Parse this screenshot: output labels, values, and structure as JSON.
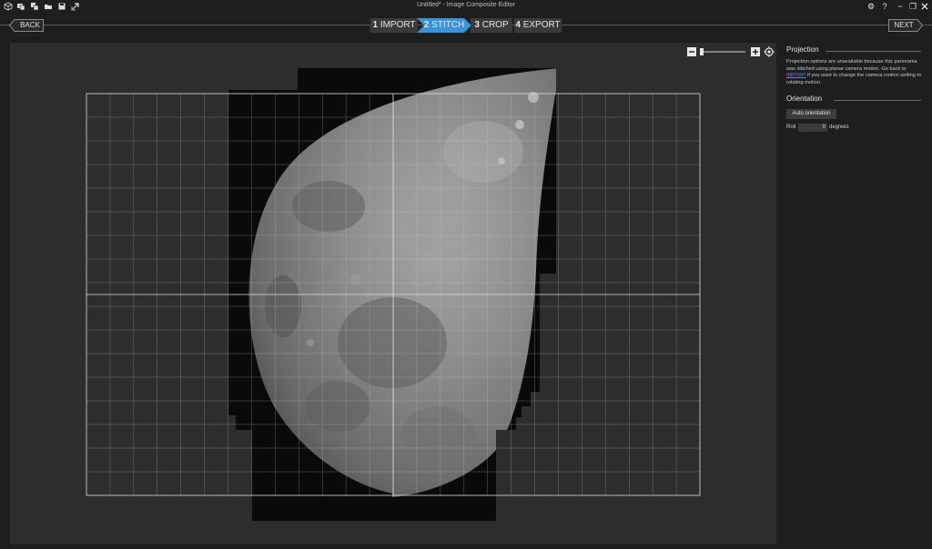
{
  "window": {
    "title": "Untitled* - Image Composite Editor"
  },
  "toolbar_icons": [
    "new-project-icon",
    "new-panorama-icon",
    "new-video-panorama-icon",
    "open-icon",
    "save-icon",
    "publish-icon"
  ],
  "window_controls": {
    "settings": "⚙",
    "help": "?",
    "minimize": "−",
    "restore": "❐"
  },
  "nav": {
    "back_label": "BACK",
    "next_label": "NEXT",
    "steps": [
      {
        "num": "1",
        "label": "IMPORT",
        "active": false
      },
      {
        "num": "2",
        "label": "STITCH",
        "active": true
      },
      {
        "num": "3",
        "label": "CROP",
        "active": false
      },
      {
        "num": "4",
        "label": "EXPORT",
        "active": false
      }
    ]
  },
  "colors": {
    "active_step": "#3794d8",
    "inactive_step": "#3a3a3a",
    "canvas": "#2d2d2d",
    "grid": "#c8c8c8",
    "link": "#3a9ad9"
  },
  "zoom": {
    "minus": "−",
    "plus": "+",
    "level": 0.0
  },
  "panel": {
    "projection": {
      "title": "Projection",
      "desc_1": "Projection options are unavailable because this panorama was stitched using planar camera motion. Go back to ",
      "link": "IMPORT",
      "desc_2": " if you want to change the camera motion setting to rotating motion."
    },
    "orientation": {
      "title": "Orientation",
      "auto_button": "Auto orientation",
      "roll_label": "Roll",
      "roll_value": "0",
      "roll_unit": "degrees"
    }
  }
}
